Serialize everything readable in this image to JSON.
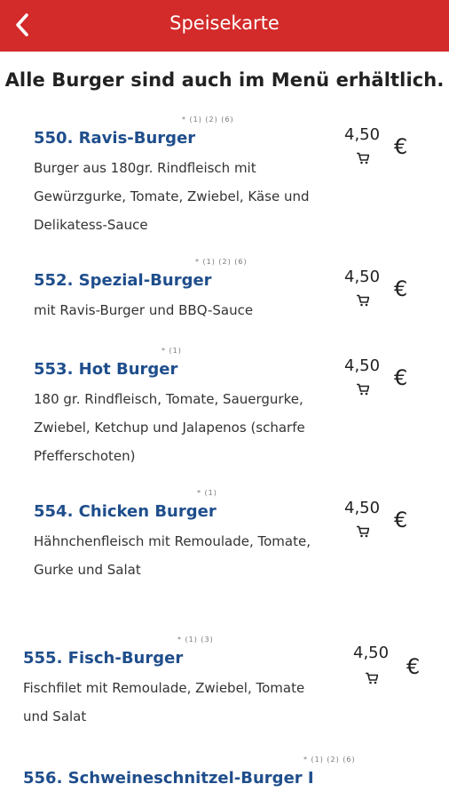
{
  "header": {
    "title": "Speisekarte",
    "back_icon": "chevron-left-icon"
  },
  "headline": "Alle Burger sind auch im Menü erhältlich.",
  "items": [
    {
      "name": "550. Ravis-Burger",
      "footnotes": "* (1) (2) (6)",
      "price": "4,50",
      "currency": "€",
      "description": "Burger aus 180gr. Rindfleisch mit Gewürzgurke, Tomate, Zwiebel, Käse und Delikatess-Sauce"
    },
    {
      "name": "552. Spezial-Burger",
      "footnotes": "* (1) (2) (6)",
      "price": "4,50",
      "currency": "€",
      "description": "mit Ravis-Burger und BBQ-Sauce"
    },
    {
      "name": "553. Hot Burger",
      "footnotes": "* (1)",
      "price": "4,50",
      "currency": "€",
      "description": "180 gr. Rindfleisch, Tomate, Sauergurke, Zwiebel, Ketchup und Jalapenos (scharfe Pfefferschoten)"
    },
    {
      "name": "554. Chicken Burger",
      "footnotes": "* (1)",
      "price": "4,50",
      "currency": "€",
      "description": "Hähnchenfleisch mit Remoulade, Tomate, Gurke und Salat"
    },
    {
      "name": "555. Fisch-Burger",
      "footnotes": "* (1) (3)",
      "price": "4,50",
      "currency": "€",
      "description": "Fischfilet mit Remoulade, Zwiebel, Tomate und Salat"
    },
    {
      "name": "556. Schweineschnitzel-Burger I",
      "footnotes": "* (1) (2) (6)",
      "price": "",
      "currency": "",
      "description": ""
    }
  ]
}
